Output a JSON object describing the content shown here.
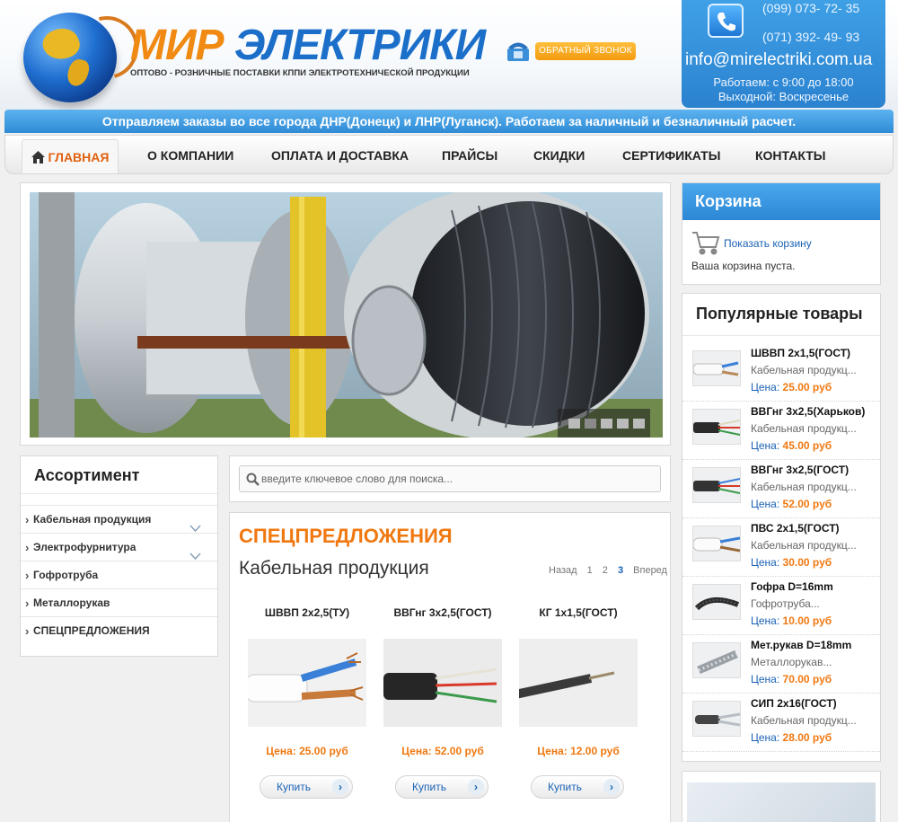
{
  "header": {
    "logo_word1": "МИР",
    "logo_word2": "ЭЛЕКТРИКИ",
    "tagline": "ОПТОВО - РОЗНИЧНЫЕ ПОСТАВКИ КППИ ЭЛЕКТРОТЕХНИЧЕСКОЙ ПРОДУКЦИИ",
    "callback_label": "ОБРАТНЫЙ ЗВОНОК",
    "phone1": "(099)  073- 72- 35",
    "phone2": "(071)  392- 49- 93",
    "email": "info@mirelectriki.com.ua",
    "hours": "Работаем: с 9:00 до 18:00",
    "dayoff": "Выходной: Воскресенье"
  },
  "info_bar": "Отправляем заказы во все города ДНР(Донецк) и ЛНР(Луганск). Работаем за наличный и безналичный расчет.",
  "nav": {
    "items": [
      "ГЛАВНАЯ",
      "О КОМПАНИИ",
      "ОПЛАТА И ДОСТАВКА",
      "ПРАЙСЫ",
      "СКИДКИ",
      "СЕРТИФИКАТЫ",
      "КОНТАКТЫ"
    ],
    "active": "ГЛАВНАЯ"
  },
  "cart": {
    "title": "Корзина",
    "link": "Показать корзину",
    "empty": "Ваша корзина пуста."
  },
  "popular": {
    "title": "Популярные товары",
    "items": [
      {
        "name": "ШВВП 2х1,5(ГОСТ)",
        "category": "Кабельная продукц...",
        "price_label": "Цена:",
        "price": "25.00 руб"
      },
      {
        "name": "ВВГнг 3х2,5(Харьков)",
        "category": "Кабельная продукц...",
        "price_label": "Цена:",
        "price": "45.00 руб"
      },
      {
        "name": "ВВГнг 3х2,5(ГОСТ)",
        "category": "Кабельная продукц...",
        "price_label": "Цена:",
        "price": "52.00 руб"
      },
      {
        "name": "ПВС 2х1,5(ГОСТ)",
        "category": "Кабельная продукц...",
        "price_label": "Цена:",
        "price": "30.00 руб"
      },
      {
        "name": "Гофра D=16mm",
        "category": "Гофротруба...",
        "price_label": "Цена:",
        "price": "10.00 руб"
      },
      {
        "name": "Мет.рукав D=18mm",
        "category": "Металлорукав...",
        "price_label": "Цена:",
        "price": "70.00 руб"
      },
      {
        "name": "СИП 2х16(ГОСТ)",
        "category": "Кабельная продукц...",
        "price_label": "Цена:",
        "price": "28.00 руб"
      }
    ]
  },
  "assortment": {
    "title": "Ассортимент",
    "items": [
      "Кабельная продукция",
      "Электрофурнитура",
      "Гофротруба",
      "Металлорукав",
      "СПЕЦПРЕДЛОЖЕНИЯ"
    ]
  },
  "search": {
    "placeholder": "введите ключевое слово для поиска..."
  },
  "specials": {
    "title": "СПЕЦПРЕДЛОЖЕНИЯ",
    "subtitle": "Кабельная продукция",
    "pager": {
      "prev": "Назад",
      "pages": [
        "1",
        "2",
        "3"
      ],
      "current": "3",
      "next": "Вперед"
    },
    "products": [
      {
        "name": "ШВВП 2х2,5(ТУ)",
        "price": "Цена: 25.00 руб",
        "buy": "Купить"
      },
      {
        "name": "ВВГнг 3х2,5(ГОСТ)",
        "price": "Цена: 52.00 руб",
        "buy": "Купить"
      },
      {
        "name": "КГ 1х1,5(ГОСТ)",
        "price": "Цена: 12.00 руб",
        "buy": "Купить"
      }
    ]
  },
  "slider": {
    "dot_count": 5
  },
  "colors": {
    "accent_orange": "#f07810",
    "brand_blue": "#2c87d4",
    "link_blue": "#1a62b5"
  }
}
